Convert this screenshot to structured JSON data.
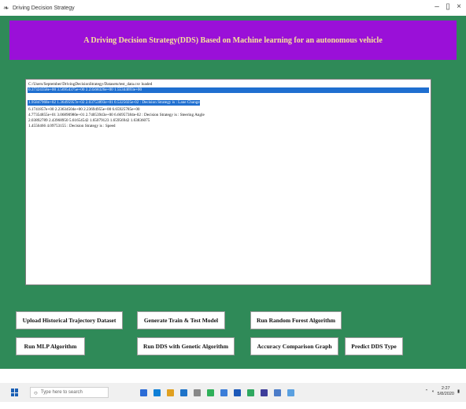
{
  "window": {
    "title": "Driving Decision Strategy",
    "minimize": "–",
    "maximize": "▯",
    "close": "×"
  },
  "banner": {
    "text": "A Driving Decision Strategy(DDS) Based on Machine learning for an autonomous vehicle",
    "color": "#9a10d8",
    "text_color": "#f6e39a"
  },
  "output": {
    "lines": [
      "C:/Users/September/DrivingDecisionStrategy/Datasets/test_data.csv loaded",
      "0.37324358e+00 3.56954375e+00 2.23568326e+00 1.55344693e+00",
      "1.95847968e+02 1.36495957e+02 2.03753893e+01 0.5325025e-02 : Decision Strategy is : Lane Change",
      "6.1741857e+00 2.23634504e+00 2.23694955e+00 6.65925785e+00",
      "4.77354855e+01 3.06890980e+01 2.74053943e+00 6.66957384e-02 : Decision Strategy is : Steering Angle",
      "2.03892789 2.43968950 5.61654542 1.65079123 1.65956942 1.63836075",
      "1.4556466 4.09753155 : Decision Strategy is : Speed"
    ],
    "selected_lines": [
      1,
      2
    ]
  },
  "buttons": {
    "upload": "Upload Historical Trajectory Dataset",
    "generate": "Generate Train & Test Model",
    "random_forest": "Run Random Forest Algorithm",
    "mlp": "Run MLP Algorithm",
    "dds_genetic": "Run DDS with Genetic Algorithm",
    "accuracy_graph": "Accuracy Comparison Graph",
    "predict": "Predict DDS Type"
  },
  "taskbar": {
    "search_placeholder": "Type here to search",
    "time": "2:27",
    "date": "5/8/2020"
  },
  "colors": {
    "background": "#2f8a58",
    "selection": "#1f6fd0"
  }
}
